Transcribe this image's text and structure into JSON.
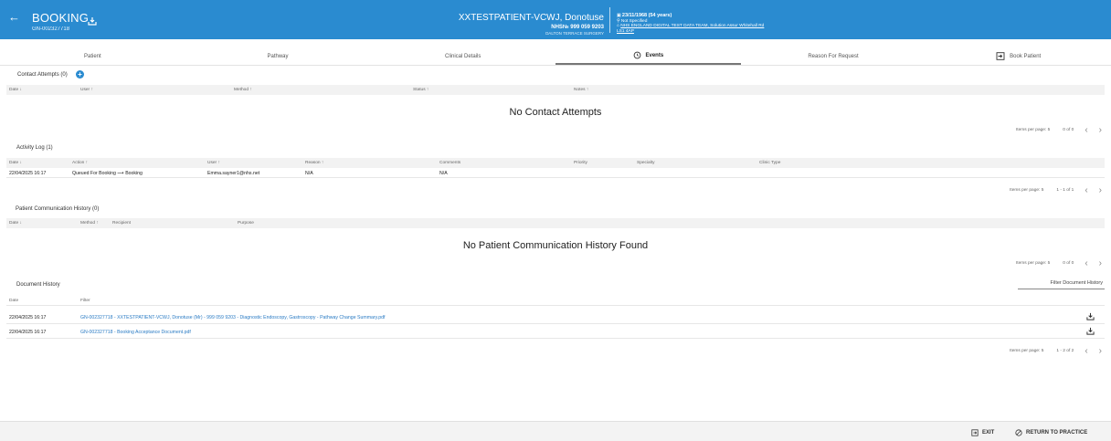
{
  "header": {
    "title": "BOOKING",
    "booking_id": "GN-002327718",
    "patient_name": "XXTESTPATIENT-VCWJ, Donotuse",
    "nhs_number": "NHS№ 999 059 9203",
    "surgery": "DALTON TERRACE SURGERY",
    "dob": "23/11/1968 (54 years)",
    "gender": "Not Specified",
    "address_line1": "NHS ENGLAND DIGITAL TEST DATA TEAM, Solution Assur Whitehall Rd",
    "address_line2": "LS1 4AP",
    "accent_color": "#2a8bd0"
  },
  "tabs": [
    {
      "label": "Patient"
    },
    {
      "label": "Pathway"
    },
    {
      "label": "Clinical Details"
    },
    {
      "label": "Events"
    },
    {
      "label": "Reason For Request"
    },
    {
      "label": "Book Patient"
    }
  ],
  "contact_attempts": {
    "title": "Contact Attempts (0)",
    "columns": [
      "Date ↓",
      "User ↑",
      "Method ↑",
      "Status ↑",
      "Notes ↑"
    ],
    "empty_message": "No Contact Attempts",
    "pager": {
      "items_per_page": "Items per page: 5",
      "range": "0 of 0"
    }
  },
  "activity_log": {
    "title": "Activity Log (1)",
    "columns": [
      "Date ↓",
      "Action ↑",
      "User ↑",
      "Reason ↑",
      "Comments",
      "Priority",
      "Specialty",
      "Clinic Type"
    ],
    "rows": [
      {
        "date": "22/04/2025 16:17",
        "action": "Queued For Booking ⟶ Booking",
        "user": "Emma.sayner1@nhs.net",
        "reason": "N/A",
        "comments": "N/A"
      }
    ],
    "pager": {
      "items_per_page": "Items per page: 5",
      "range": "1 - 1 of 1"
    }
  },
  "communication_history": {
    "title": "Patient Communication History (0)",
    "columns": [
      "Date ↓",
      "Method ↑",
      "Recipient",
      "Purpose"
    ],
    "empty_message": "No Patient Communication History Found",
    "pager": {
      "items_per_page": "Items per page: 5",
      "range": "0 of 0"
    }
  },
  "document_history": {
    "title": "Document History",
    "filter_placeholder": "Filter Document History",
    "columns": [
      "Date",
      "Filter"
    ],
    "rows": [
      {
        "date": "22/04/2025 16:17",
        "file": "GN-002327718 - XXTESTPATIENT-VCWJ, Donotuse (Mr) - 999 059 9203 - Diagnostic Endoscopy, Gastroscopy - Pathway Change Summary.pdf"
      },
      {
        "date": "22/04/2025 16:17",
        "file": "GN-002327718 - Booking Acceptance Document.pdf"
      }
    ],
    "pager": {
      "items_per_page": "Items per page: 5",
      "range": "1 - 2 of 2"
    }
  },
  "footer": {
    "exit_label": "EXIT",
    "return_label": "RETURN TO PRACTICE"
  }
}
